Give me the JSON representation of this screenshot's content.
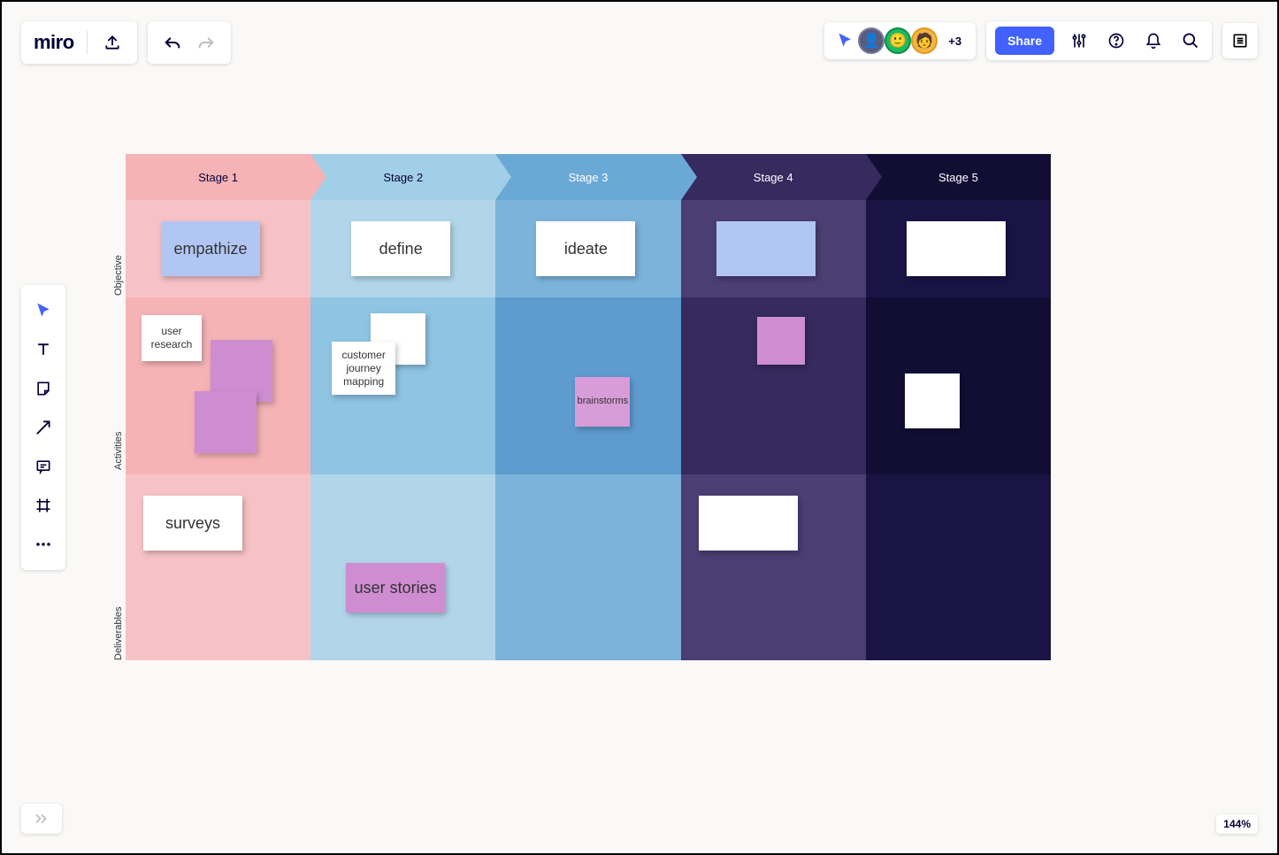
{
  "app": {
    "name": "miro"
  },
  "collab": {
    "extra": "+3",
    "share": "Share"
  },
  "zoom": "144%",
  "stages": [
    "Stage 1",
    "Stage 2",
    "Stage 3",
    "Stage 4",
    "Stage 5"
  ],
  "rows": [
    "Objective",
    "Activities",
    "Deliverables"
  ],
  "notes": {
    "empathize": "empathize",
    "define": "define",
    "ideate": "ideate",
    "user_research": "user research",
    "cjm": "customer journey mapping",
    "brainstorms": "brainstorms",
    "surveys": "surveys",
    "user_stories": "user stories"
  }
}
